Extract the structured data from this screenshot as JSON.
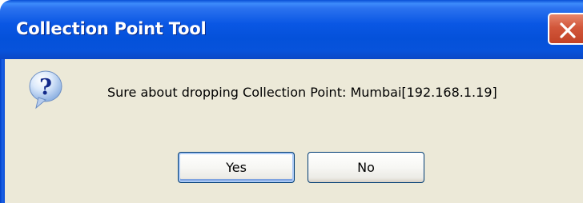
{
  "dialog": {
    "title": "Collection Point Tool",
    "message": "Sure about dropping Collection Point: Mumbai[192.168.1.19]",
    "icon": "question-icon",
    "buttons": {
      "yes_label": "Yes",
      "no_label": "No"
    }
  },
  "colors": {
    "titlebar": "#0a57e4",
    "dialog_background": "#ece9d8",
    "close_button": "#d2573b",
    "button_border": "#003c74"
  }
}
